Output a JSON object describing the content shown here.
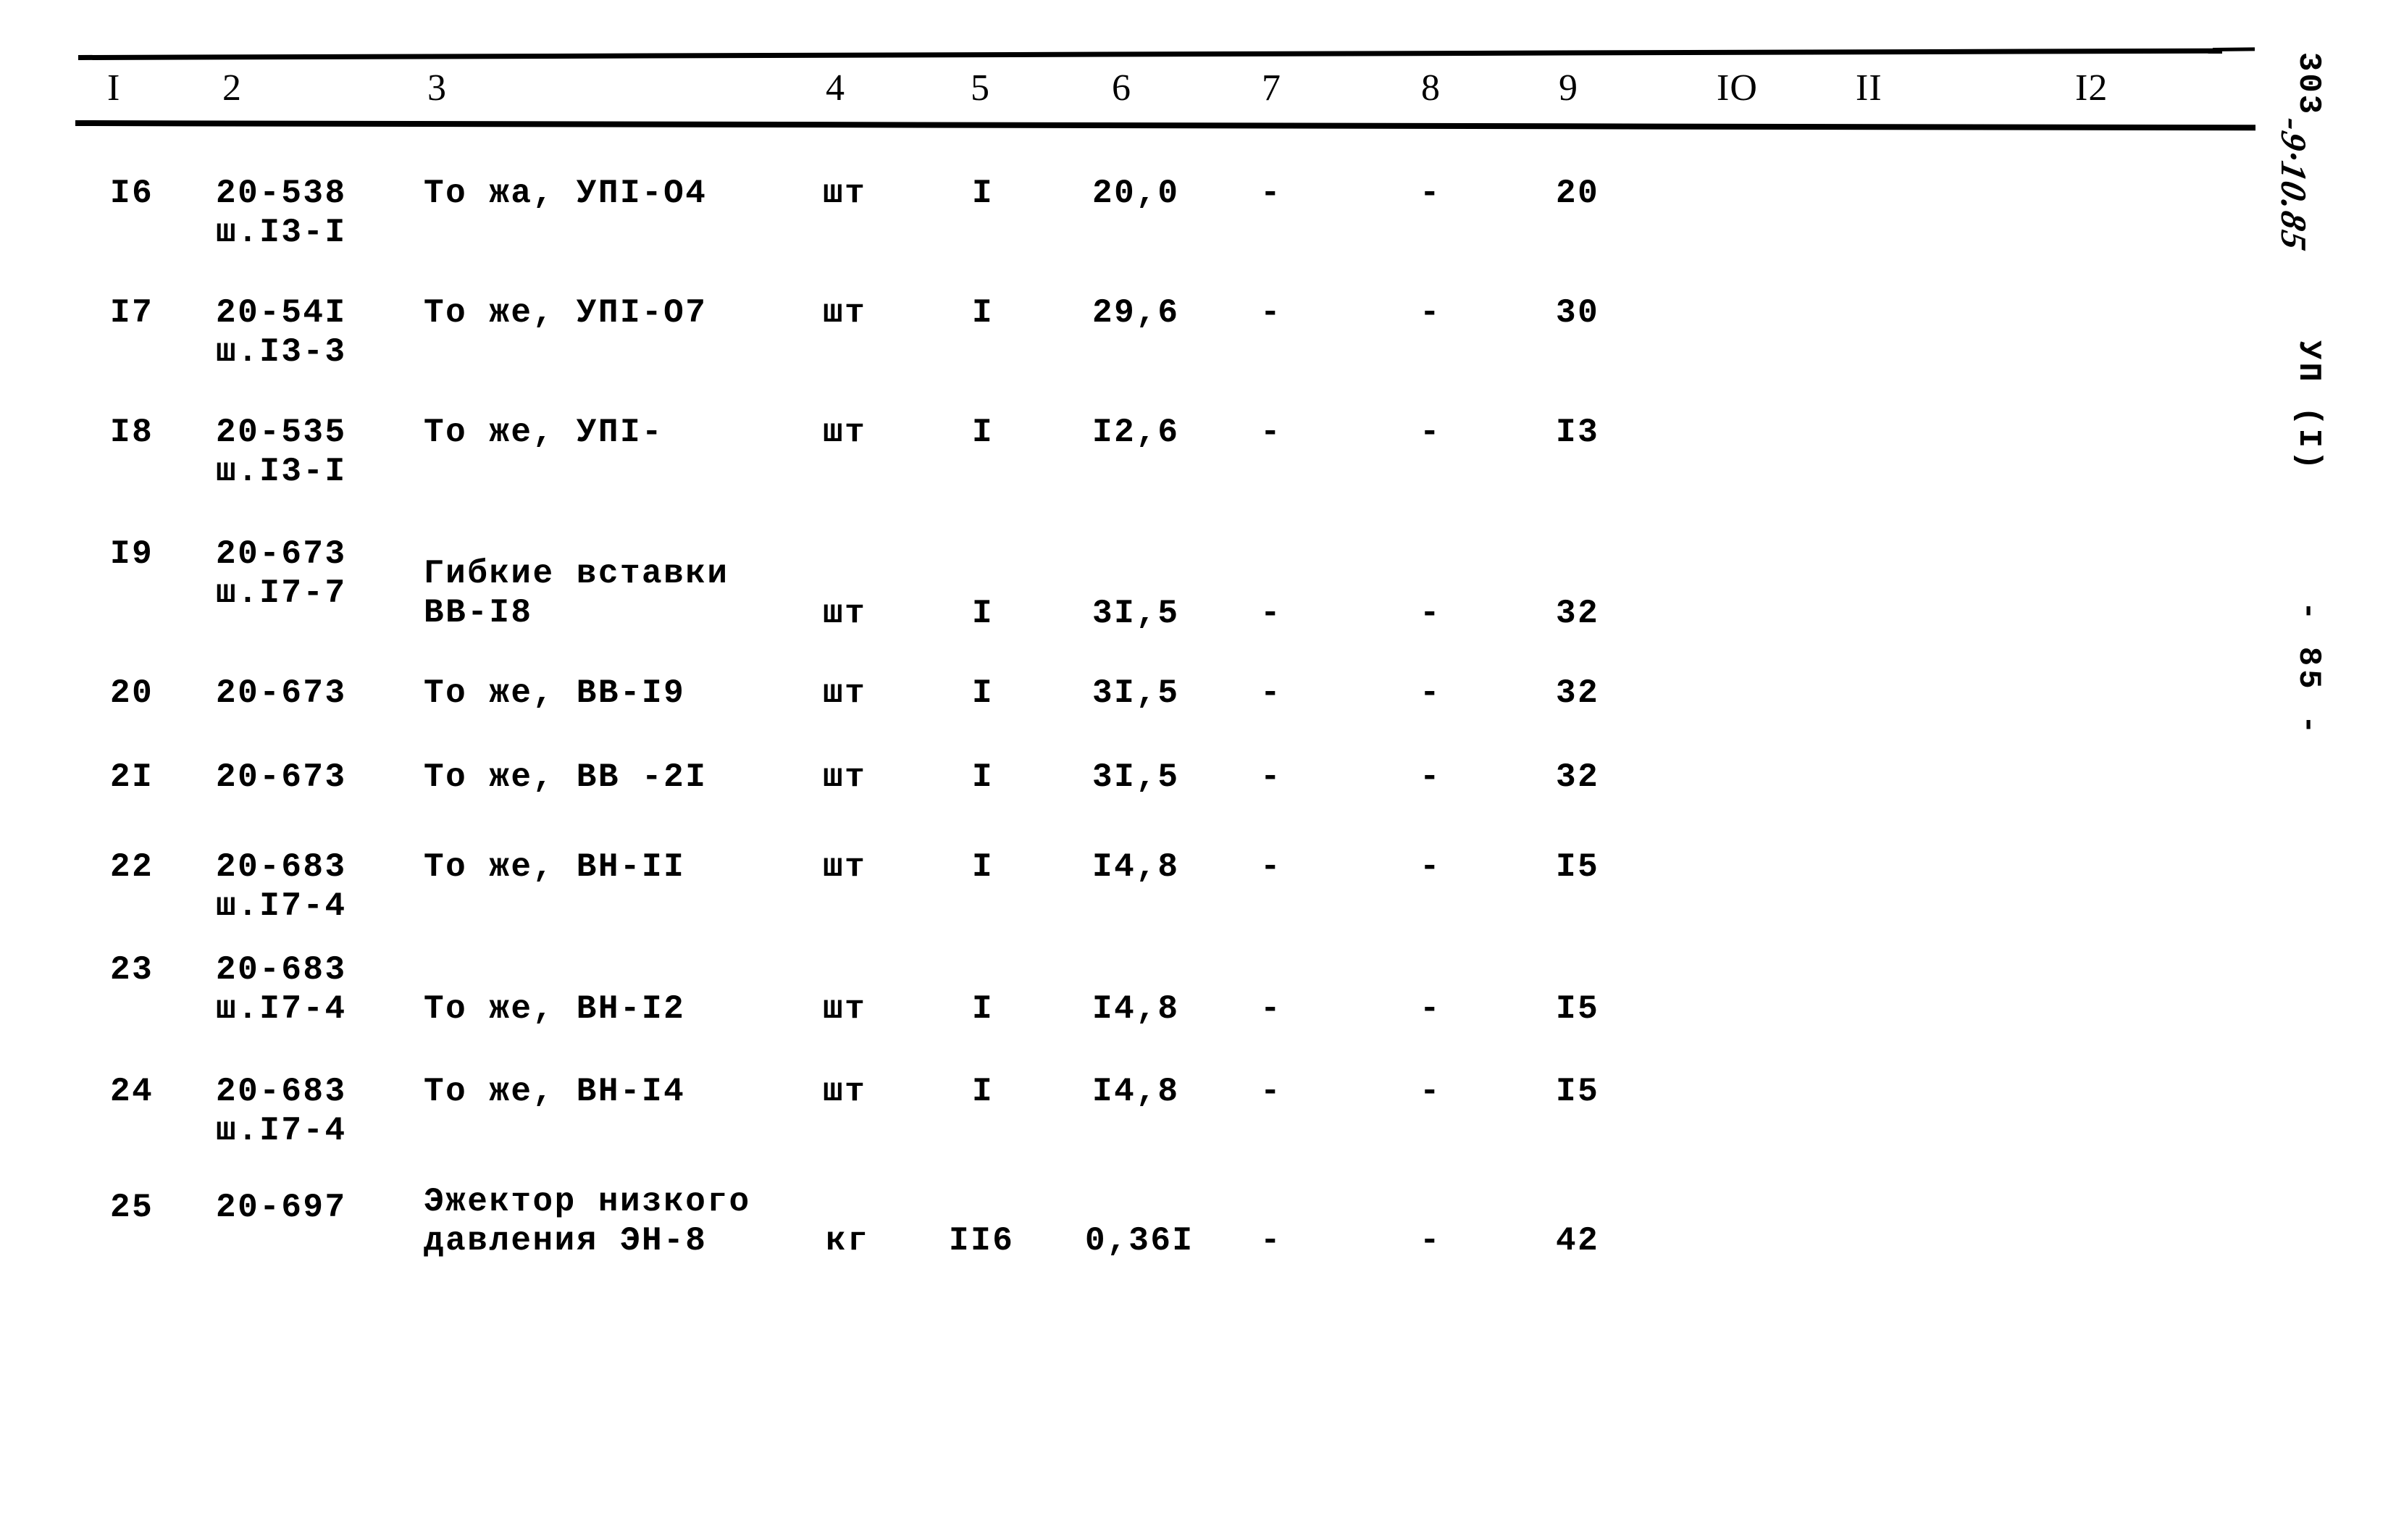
{
  "document": {
    "kind": "scanned-specification-table",
    "margin": {
      "catalog_code": "303",
      "handwritten_mark": "-9·10.85",
      "sheet_label": "УП (I)",
      "page_number": "- 85 -"
    }
  },
  "table": {
    "column_headers": [
      "I",
      "2",
      "3",
      "4",
      "5",
      "6",
      "7",
      "8",
      "9",
      "IO",
      "II",
      "I2"
    ],
    "rows": [
      {
        "no": "I6",
        "code_line1": "20-538",
        "code_line2": "ш.I3-I",
        "desc_line1": "То жа, УПI-О4",
        "desc_line2": "",
        "unit": "шт",
        "qty": "I",
        "mass": "20,0",
        "c7": "-",
        "c8": "-",
        "c9": "20"
      },
      {
        "no": "I7",
        "code_line1": "20-54I",
        "code_line2": "ш.I3-3",
        "desc_line1": "То же, УПI-О7",
        "desc_line2": "",
        "unit": "шт",
        "qty": "I",
        "mass": "29,6",
        "c7": "-",
        "c8": "-",
        "c9": "30"
      },
      {
        "no": "I8",
        "code_line1": "20-535",
        "code_line2": "ш.I3-I",
        "desc_line1": "То же, УПI-",
        "desc_line2": "",
        "unit": "шт",
        "qty": "I",
        "mass": "I2,6",
        "c7": "-",
        "c8": "-",
        "c9": "I3"
      },
      {
        "no": "I9",
        "code_line1": "20-673",
        "code_line2": "ш.I7-7",
        "desc_line1": "Гибкие вставки",
        "desc_line2": "ВВ-I8",
        "unit": "шт",
        "qty": "I",
        "mass": "3I,5",
        "c7": "-",
        "c8": "-",
        "c9": "32"
      },
      {
        "no": "20",
        "code_line1": "20-673",
        "code_line2": "",
        "desc_line1": "То же, ВВ-I9",
        "desc_line2": "",
        "unit": "шт",
        "qty": "I",
        "mass": "3I,5",
        "c7": "-",
        "c8": "-",
        "c9": "32"
      },
      {
        "no": "2I",
        "code_line1": "20-673",
        "code_line2": "",
        "desc_line1": "То же, ВВ -2I",
        "desc_line2": "",
        "unit": "шт",
        "qty": "I",
        "mass": "3I,5",
        "c7": "-",
        "c8": "-",
        "c9": "32"
      },
      {
        "no": "22",
        "code_line1": "20-683",
        "code_line2": "ш.I7-4",
        "desc_line1": "То же, ВН-II",
        "desc_line2": "",
        "unit": "шт",
        "qty": "I",
        "mass": "I4,8",
        "c7": "-",
        "c8": "-",
        "c9": "I5"
      },
      {
        "no": "23",
        "code_line1": "20-683",
        "code_line2": "ш.I7-4",
        "desc_line1": "То же, ВН-I2",
        "desc_line2": "",
        "unit": "шт",
        "qty": "I",
        "mass": "I4,8",
        "c7": "-",
        "c8": "-",
        "c9": "I5"
      },
      {
        "no": "24",
        "code_line1": "20-683",
        "code_line2": "ш.I7-4",
        "desc_line1": "То же, ВН-I4",
        "desc_line2": "",
        "unit": "шт",
        "qty": "I",
        "mass": "I4,8",
        "c7": "-",
        "c8": "-",
        "c9": "I5"
      },
      {
        "no": "25",
        "code_line1": "20-697",
        "code_line2": "",
        "desc_line1": "Эжектор низкого",
        "desc_line2": "давления ЭН-8",
        "unit": "кг",
        "qty": "II6",
        "mass": "0,36I",
        "c7": "-",
        "c8": "-",
        "c9": "42"
      }
    ]
  }
}
